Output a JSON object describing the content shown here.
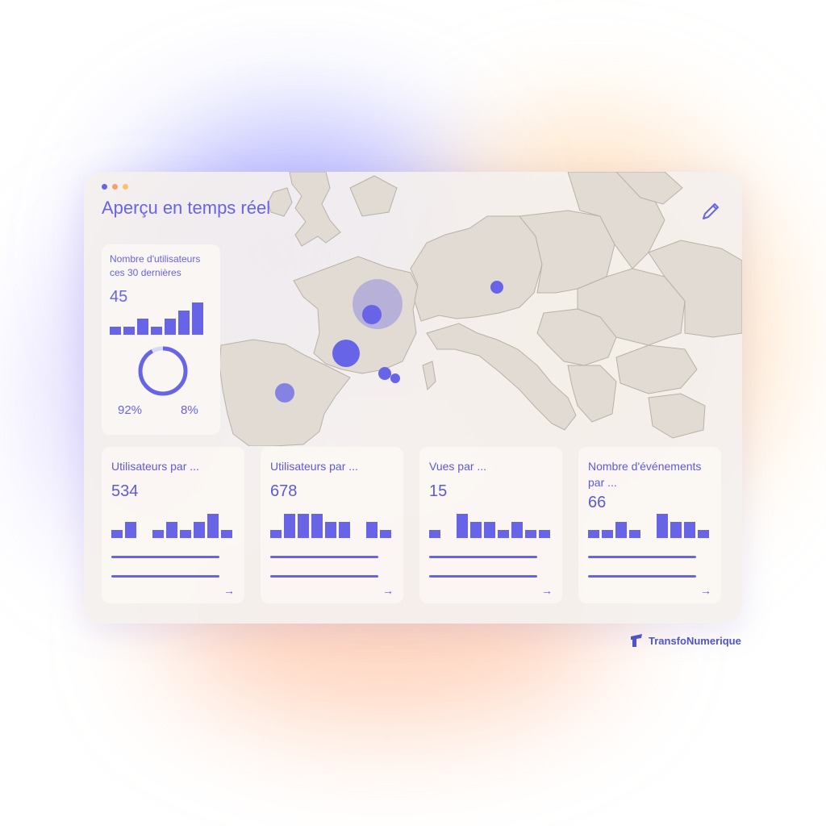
{
  "colors": {
    "accent": "#6764e8",
    "ring_track": "#d9d8f5"
  },
  "window": {
    "title": "Aperçu en temps réel",
    "traffic_dots": [
      "#6764e8",
      "#f3a26c",
      "#f7c46a"
    ]
  },
  "icons": {
    "edit": "pencil-icon",
    "arrow": "arrow-right-icon",
    "brand": "brand-logo-icon"
  },
  "summary": {
    "label": "Nombre d'utilisateurs ces 30 dernières",
    "value": "45",
    "bars": [
      1,
      1,
      2,
      1,
      2,
      3,
      4
    ],
    "ring": {
      "primary_pct": 92,
      "secondary_pct": 8
    },
    "pct_primary": "92%",
    "pct_secondary": "8%"
  },
  "cards": [
    {
      "label": "Utilisateurs par ...",
      "value": "534",
      "bars": [
        1,
        2,
        0,
        1,
        2,
        1,
        2,
        3,
        1
      ]
    },
    {
      "label": "Utilisateurs par ...",
      "value": "678",
      "bars": [
        1,
        3,
        3,
        3,
        2,
        2,
        0,
        2,
        1
      ]
    },
    {
      "label": "Vues par ...",
      "value": "15",
      "bars": [
        1,
        0,
        3,
        2,
        2,
        1,
        2,
        1,
        1
      ]
    },
    {
      "label": "Nombre d'événements par ...",
      "value": "66",
      "bars": [
        1,
        1,
        2,
        1,
        0,
        3,
        2,
        2,
        1
      ]
    }
  ],
  "brand": {
    "name": "TransfoNumerique"
  }
}
